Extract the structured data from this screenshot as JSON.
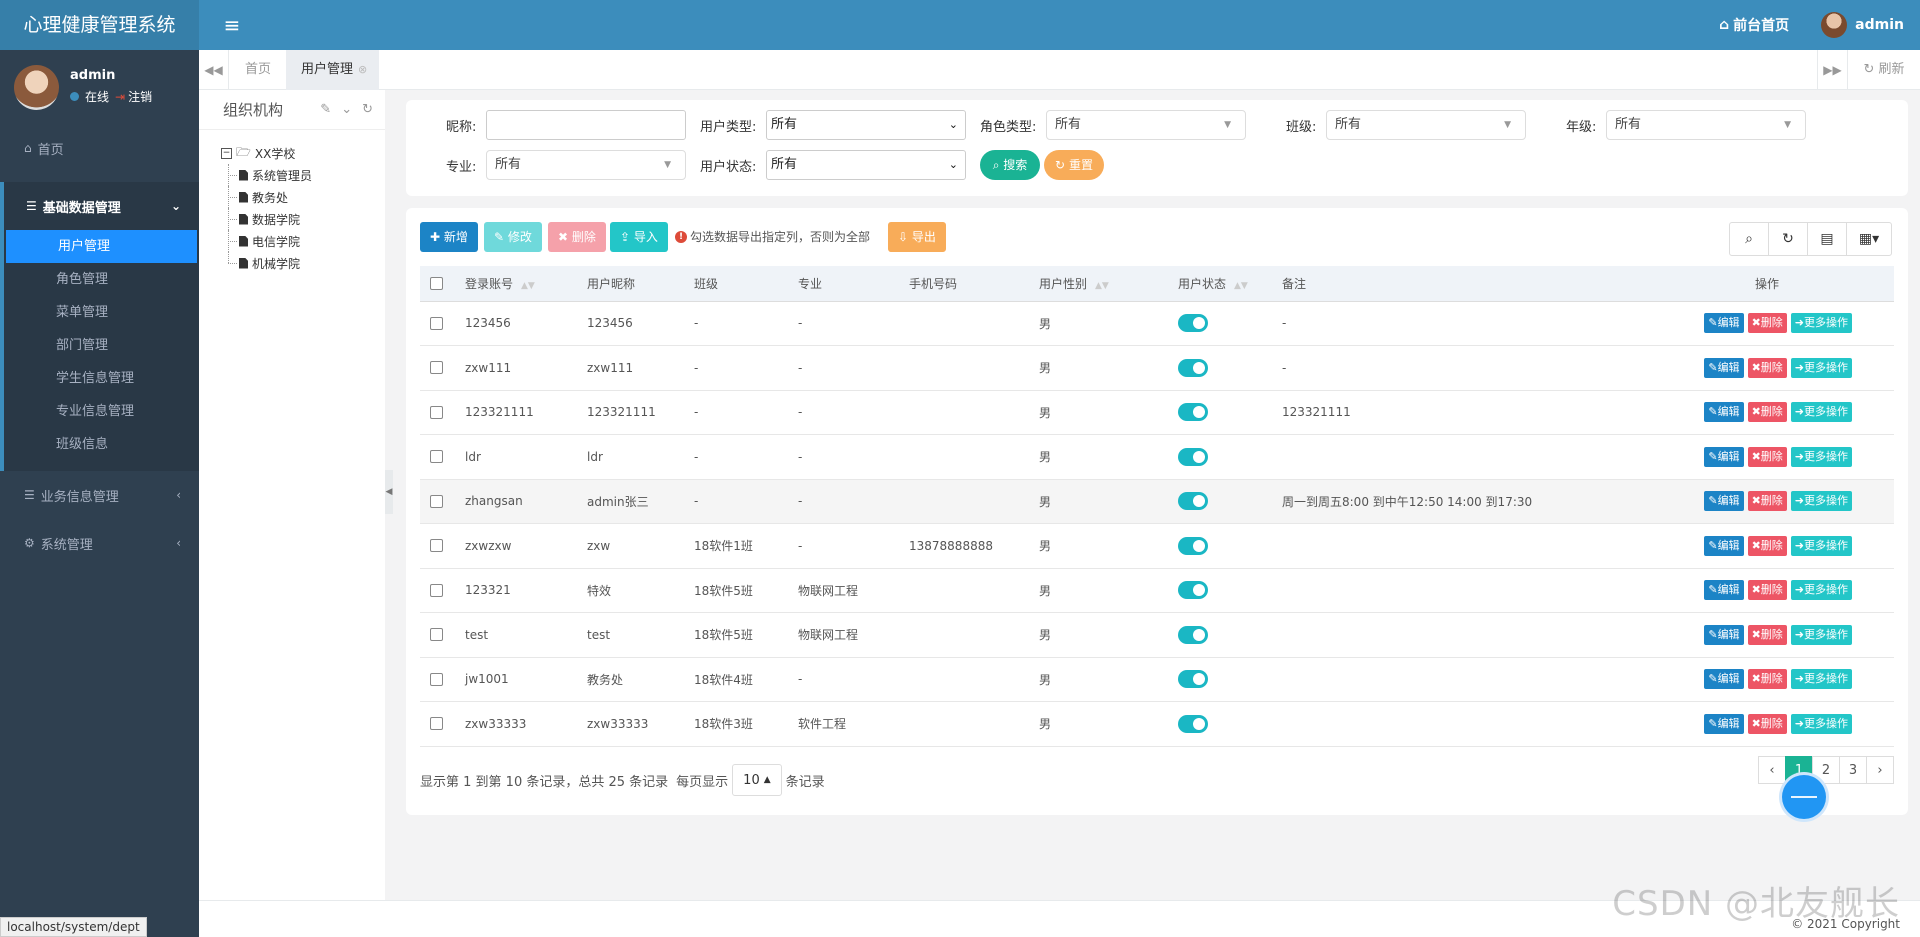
{
  "header": {
    "app_title": "心理健康管理系统",
    "menu_toggle": "≡",
    "front_link": "前台首页",
    "user_name": "admin"
  },
  "sidebar": {
    "user_name": "admin",
    "status_online": "在线",
    "logout": "注销",
    "home": "首页",
    "groups": [
      {
        "label": "基础数据管理",
        "icon": "database-icon",
        "open": true
      },
      {
        "label": "业务信息管理",
        "icon": "database-icon",
        "open": false
      },
      {
        "label": "系统管理",
        "icon": "gear-icon",
        "open": false
      }
    ],
    "sub_items": [
      "用户管理",
      "角色管理",
      "菜单管理",
      "部门管理",
      "学生信息管理",
      "专业信息管理",
      "班级信息"
    ],
    "active_item": "用户管理",
    "status_url": "localhost/system/dept"
  },
  "tabs": {
    "home": "首页",
    "active": "用户管理",
    "refresh": "刷新"
  },
  "org": {
    "title": "组织机构",
    "root": "XX学校",
    "children": [
      "系统管理员",
      "教务处",
      "数据学院",
      "电信学院",
      "机械学院"
    ]
  },
  "search": {
    "nickname_label": "昵称:",
    "nickname_value": "",
    "user_type_label": "用户类型:",
    "user_type_value": "所有",
    "role_type_label": "角色类型:",
    "role_type_value": "所有",
    "class_label": "班级:",
    "class_value": "所有",
    "grade_label": "年级:",
    "grade_value": "所有",
    "major_label": "专业:",
    "major_value": "所有",
    "user_status_label": "用户状态:",
    "user_status_value": "所有",
    "search_btn": "搜索",
    "reset_btn": "重置"
  },
  "toolbar": {
    "add": "新增",
    "edit": "修改",
    "delete": "删除",
    "import": "导入",
    "export_tip": "勾选数据导出指定列，否则为全部",
    "export": "导出"
  },
  "table": {
    "columns": [
      "登录账号",
      "用户昵称",
      "班级",
      "专业",
      "手机号码",
      "用户性别",
      "用户状态",
      "备注",
      "操作"
    ],
    "rows": [
      {
        "account": "123456",
        "nickname": "123456",
        "class": "-",
        "major": "-",
        "phone": "",
        "gender": "男",
        "enabled": true,
        "remark": "-"
      },
      {
        "account": "zxw111",
        "nickname": "zxw111",
        "class": "-",
        "major": "-",
        "phone": "",
        "gender": "男",
        "enabled": true,
        "remark": "-"
      },
      {
        "account": "123321111",
        "nickname": "123321111",
        "class": "-",
        "major": "-",
        "phone": "",
        "gender": "男",
        "enabled": true,
        "remark": "123321111"
      },
      {
        "account": "ldr",
        "nickname": "ldr",
        "class": "-",
        "major": "-",
        "phone": "",
        "gender": "男",
        "enabled": true,
        "remark": ""
      },
      {
        "account": "zhangsan",
        "nickname": "admin张三",
        "class": "-",
        "major": "-",
        "phone": "",
        "gender": "男",
        "enabled": true,
        "remark": "周一到周五8:00 到中午12:50 14:00 到17:30"
      },
      {
        "account": "zxwzxw",
        "nickname": "zxw",
        "class": "18软件1班",
        "major": "-",
        "phone": "13878888888",
        "gender": "男",
        "enabled": true,
        "remark": ""
      },
      {
        "account": "123321",
        "nickname": "特效",
        "class": "18软件5班",
        "major": "物联网工程",
        "phone": "",
        "gender": "男",
        "enabled": true,
        "remark": ""
      },
      {
        "account": "test",
        "nickname": "test",
        "class": "18软件5班",
        "major": "物联网工程",
        "phone": "",
        "gender": "男",
        "enabled": true,
        "remark": ""
      },
      {
        "account": "jw1001",
        "nickname": "教务处",
        "class": "18软件4班",
        "major": "-",
        "phone": "",
        "gender": "男",
        "enabled": true,
        "remark": ""
      },
      {
        "account": "zxw33333",
        "nickname": "zxw33333",
        "class": "18软件3班",
        "major": "软件工程",
        "phone": "",
        "gender": "男",
        "enabled": true,
        "remark": ""
      }
    ],
    "row_ops": {
      "edit": "编辑",
      "delete": "删除",
      "more": "更多操作"
    }
  },
  "pagination": {
    "info_prefix": "显示第 1 到第 10 条记录，总共 25 条记录",
    "per_page_label": "每页显示",
    "page_size": "10",
    "per_page_suffix": "条记录",
    "pages": [
      "1",
      "2",
      "3"
    ],
    "current": "1",
    "prev": "‹",
    "next": "›"
  },
  "footer": {
    "copyright": "© 2021 Copyright",
    "watermark": "CSDN @北友舰长"
  },
  "colors": {
    "header": "#3c8dbc",
    "sidebar": "#2f4050",
    "active_item": "#1e90ff",
    "add": "#1c84c6",
    "edit": "#23c6c8",
    "delete": "#ed5565",
    "import": "#23c6c8",
    "export": "#f8ac59",
    "search": "#1ab394",
    "reset": "#f8ac59"
  }
}
